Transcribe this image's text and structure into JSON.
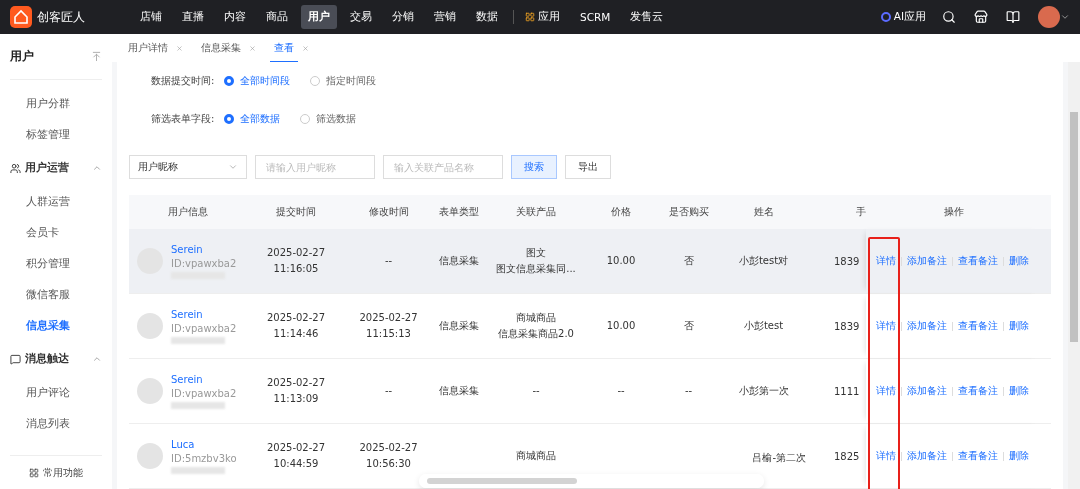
{
  "brand": {
    "name": "创客匠人"
  },
  "nav": [
    {
      "label": "店铺",
      "kind": "text",
      "selected": false
    },
    {
      "label": "直播",
      "kind": "text",
      "selected": false
    },
    {
      "label": "内容",
      "kind": "text",
      "selected": false
    },
    {
      "label": "商品",
      "kind": "text",
      "selected": false
    },
    {
      "label": "用户",
      "kind": "text",
      "selected": true
    },
    {
      "label": "交易",
      "kind": "text",
      "selected": false
    },
    {
      "label": "分销",
      "kind": "text",
      "selected": false
    },
    {
      "label": "营销",
      "kind": "text",
      "selected": false
    },
    {
      "label": "数据",
      "kind": "text",
      "selected": false
    },
    {
      "label": "应用",
      "kind": "apps",
      "selected": false
    },
    {
      "label": "SCRM",
      "kind": "text",
      "selected": false
    },
    {
      "label": "发售云",
      "kind": "text",
      "selected": false
    }
  ],
  "ai_button": "AI应用",
  "page_tabs": [
    {
      "label": "用户详情",
      "selected": false
    },
    {
      "label": "信息采集",
      "selected": false
    },
    {
      "label": "查看",
      "selected": true
    }
  ],
  "sidebar": {
    "title": "用户",
    "items": [
      {
        "label": "用户分群",
        "selected": false
      },
      {
        "label": "标签管理",
        "selected": false
      }
    ],
    "groups": [
      {
        "title": "用户运营",
        "kind": "people",
        "expanded": true,
        "items": [
          {
            "label": "人群运营",
            "selected": false
          },
          {
            "label": "会员卡",
            "selected": false
          },
          {
            "label": "积分管理",
            "selected": false
          },
          {
            "label": "微信客服",
            "selected": false
          },
          {
            "label": "信息采集",
            "selected": true
          }
        ]
      },
      {
        "title": "消息触达",
        "kind": "message",
        "expanded": true,
        "items": [
          {
            "label": "用户评论",
            "selected": false
          },
          {
            "label": "消息列表",
            "selected": false
          }
        ]
      }
    ],
    "footer": "常用功能"
  },
  "filters": [
    {
      "label": "数据提交时间:",
      "options": [
        {
          "label": "全部时间段",
          "selected": true
        },
        {
          "label": "指定时间段",
          "selected": false
        }
      ]
    },
    {
      "label": "筛选表单字段:",
      "options": [
        {
          "label": "全部数据",
          "selected": true
        },
        {
          "label": "筛选数据",
          "selected": false
        }
      ]
    }
  ],
  "search": {
    "select": "用户昵称",
    "nickname_placeholder": "请输入用户昵称",
    "product_placeholder": "输入关联产品名称",
    "search_button": "搜索",
    "export_button": "导出"
  },
  "table": {
    "columns": [
      "用户信息",
      "提交时间",
      "修改时间",
      "表单类型",
      "关联产品",
      "价格",
      "是否购买",
      "姓名",
      "手",
      "操作"
    ],
    "rows": [
      {
        "user": "Serein",
        "id": "ID:vpawxba2",
        "submitted": [
          "2025-02-27",
          "11:16:05"
        ],
        "modified": [
          "--"
        ],
        "type": "信息采集",
        "product": [
          "图文",
          "图文信息采集同..."
        ],
        "price": "10.00",
        "purchased": "否",
        "name": "小彭test对",
        "column_9": "1839",
        "actions": [
          "详情",
          "添加备注",
          "查看备注",
          "删除"
        ],
        "hovered": true
      },
      {
        "user": "Serein",
        "id": "ID:vpawxba2",
        "submitted": [
          "2025-02-27",
          "11:14:46"
        ],
        "modified": [
          "2025-02-27",
          "11:15:13"
        ],
        "type": "信息采集",
        "product": [
          "商城商品",
          "信息采集商品2.0"
        ],
        "price": "10.00",
        "purchased": "否",
        "name": "小彭test",
        "column_9": "1839",
        "actions": [
          "详情",
          "添加备注",
          "查看备注",
          "删除"
        ],
        "hovered": false
      },
      {
        "user": "Serein",
        "id": "ID:vpawxba2",
        "submitted": [
          "2025-02-27",
          "11:13:09"
        ],
        "modified": [
          "--"
        ],
        "type": "信息采集",
        "product": [
          "--"
        ],
        "price": "--",
        "purchased": "--",
        "name": "小彭第一次",
        "column_9": "1111",
        "actions": [
          "详情",
          "添加备注",
          "查看备注",
          "删除"
        ],
        "hovered": false
      },
      {
        "user": "Luca",
        "id": "ID:5mzbv3ko",
        "submitted": [
          "2025-02-27",
          "10:44:59"
        ],
        "modified": [
          "2025-02-27",
          "10:56:30"
        ],
        "type": "",
        "product": [
          "商城商品"
        ],
        "price": "",
        "purchased": "",
        "name": "吕榆-第二次",
        "column_9": "1825",
        "actions": [
          "详情",
          "添加备注",
          "查看备注",
          "删除"
        ],
        "hovered": false
      }
    ]
  }
}
